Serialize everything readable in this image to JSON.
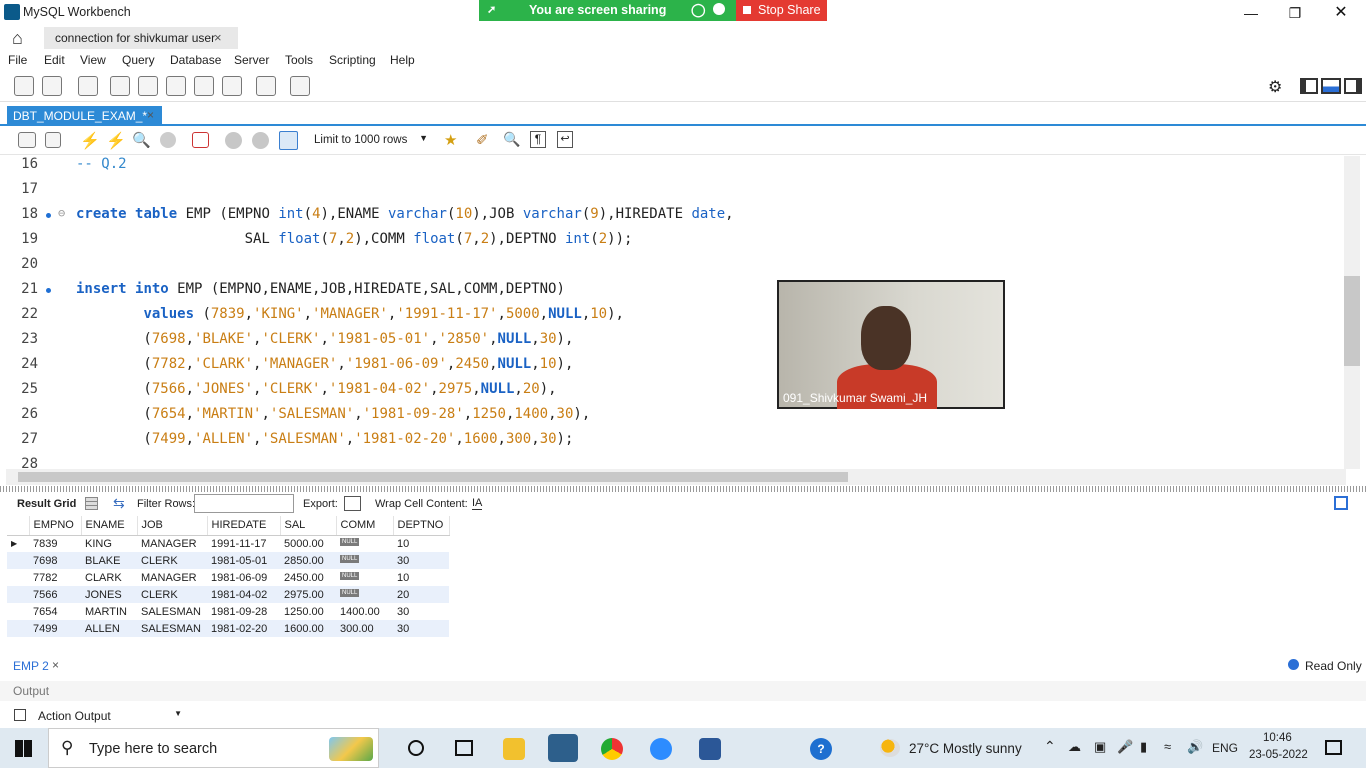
{
  "window": {
    "title": "MySQL Workbench"
  },
  "screen_share": {
    "status": "You are screen sharing",
    "stop_label": "Stop Share"
  },
  "connection_tab": {
    "label": "connection for shivkumar user",
    "close": "×"
  },
  "menu": [
    "File",
    "Edit",
    "View",
    "Query",
    "Database",
    "Server",
    "Tools",
    "Scripting",
    "Help"
  ],
  "editor_tab": {
    "label": "DBT_MODULE_EXAM_*",
    "close": "×"
  },
  "sql_toolbar": {
    "limit_label": "Limit to 1000 rows"
  },
  "editor": {
    "line_numbers": [
      "16",
      "17",
      "18",
      "19",
      "20",
      "21",
      "22",
      "23",
      "24",
      "25",
      "26",
      "27",
      "28"
    ]
  },
  "video": {
    "participant_name": "091_Shivkumar Swami_JH"
  },
  "result_toolbar": {
    "result_grid": "Result Grid",
    "filter_rows": "Filter Rows:",
    "export": "Export:",
    "wrap": "Wrap Cell Content:"
  },
  "grid": {
    "columns": [
      "EMPNO",
      "ENAME",
      "JOB",
      "HIREDATE",
      "SAL",
      "COMM",
      "DEPTNO"
    ],
    "rows": [
      [
        "7839",
        "KING",
        "MANAGER",
        "1991-11-17",
        "5000.00",
        "NULL",
        "10"
      ],
      [
        "7698",
        "BLAKE",
        "CLERK",
        "1981-05-01",
        "2850.00",
        "NULL",
        "30"
      ],
      [
        "7782",
        "CLARK",
        "MANAGER",
        "1981-06-09",
        "2450.00",
        "NULL",
        "10"
      ],
      [
        "7566",
        "JONES",
        "CLERK",
        "1981-04-02",
        "2975.00",
        "NULL",
        "20"
      ],
      [
        "7654",
        "MARTIN",
        "SALESMAN",
        "1981-09-28",
        "1250.00",
        "1400.00",
        "30"
      ],
      [
        "7499",
        "ALLEN",
        "SALESMAN",
        "1981-02-20",
        "1600.00",
        "300.00",
        "30"
      ]
    ]
  },
  "result_tab": {
    "label": "EMP 2",
    "close": "×",
    "read_only": "Read Only"
  },
  "output": {
    "label": "Output",
    "selector": "Action Output"
  },
  "taskbar": {
    "search_placeholder": "Type here to search",
    "weather": "27°C  Mostly sunny",
    "lang": "ENG",
    "time": "10:46",
    "date": "23-05-2022"
  }
}
